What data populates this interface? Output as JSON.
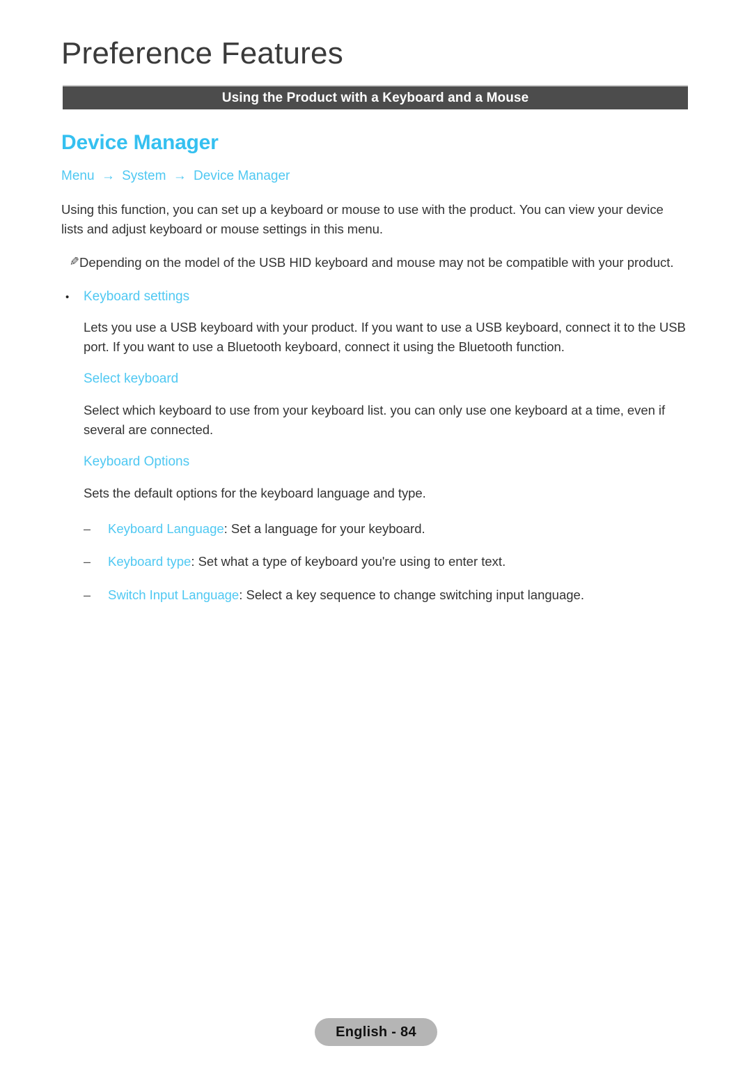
{
  "chapter": {
    "title": "Preference Features"
  },
  "section_banner": {
    "title": "Using the Product with a Keyboard and a Mouse"
  },
  "article": {
    "heading": "Device Manager",
    "breadcrumb": {
      "items": [
        "Menu",
        "System",
        "Device Manager"
      ],
      "separator": "→"
    },
    "intro": "Using this function, you can set up a keyboard or mouse to use with the product. You can view your device lists and adjust keyboard or mouse settings in this menu.",
    "note": {
      "icon": "pencil-note-icon",
      "glyph": "✎",
      "text": "Depending on the model of the USB HID keyboard and mouse may not be compatible with your product."
    },
    "bullet": {
      "marker": "•",
      "label": "Keyboard settings",
      "description": "Lets you use a USB keyboard with your product. If you want to use a USB keyboard, connect it to the USB port. If you want to use a Bluetooth keyboard, connect it using the Bluetooth function."
    },
    "subsections": [
      {
        "heading": "Select keyboard",
        "description": "Select which keyboard to use from your keyboard list. you can only use one keyboard at a time, even if several are connected."
      },
      {
        "heading": "Keyboard Options",
        "description": "Sets the default options for the keyboard language and type."
      }
    ],
    "dash_marker": "–",
    "options": [
      {
        "term": "Keyboard Language",
        "description": ": Set a language for your keyboard."
      },
      {
        "term": "Keyboard type",
        "description": ": Set what a type of keyboard you're using to enter text."
      },
      {
        "term": "Switch Input Language",
        "description": ": Select a key sequence to change switching input language."
      }
    ]
  },
  "footer": {
    "label": "English - 84"
  },
  "colors": {
    "accent_blue": "#4fc8f2",
    "heading_blue": "#35c0f0",
    "banner_gray": "#4c4c4c",
    "footer_gray": "#b5b5b5",
    "body_text": "#333333"
  }
}
